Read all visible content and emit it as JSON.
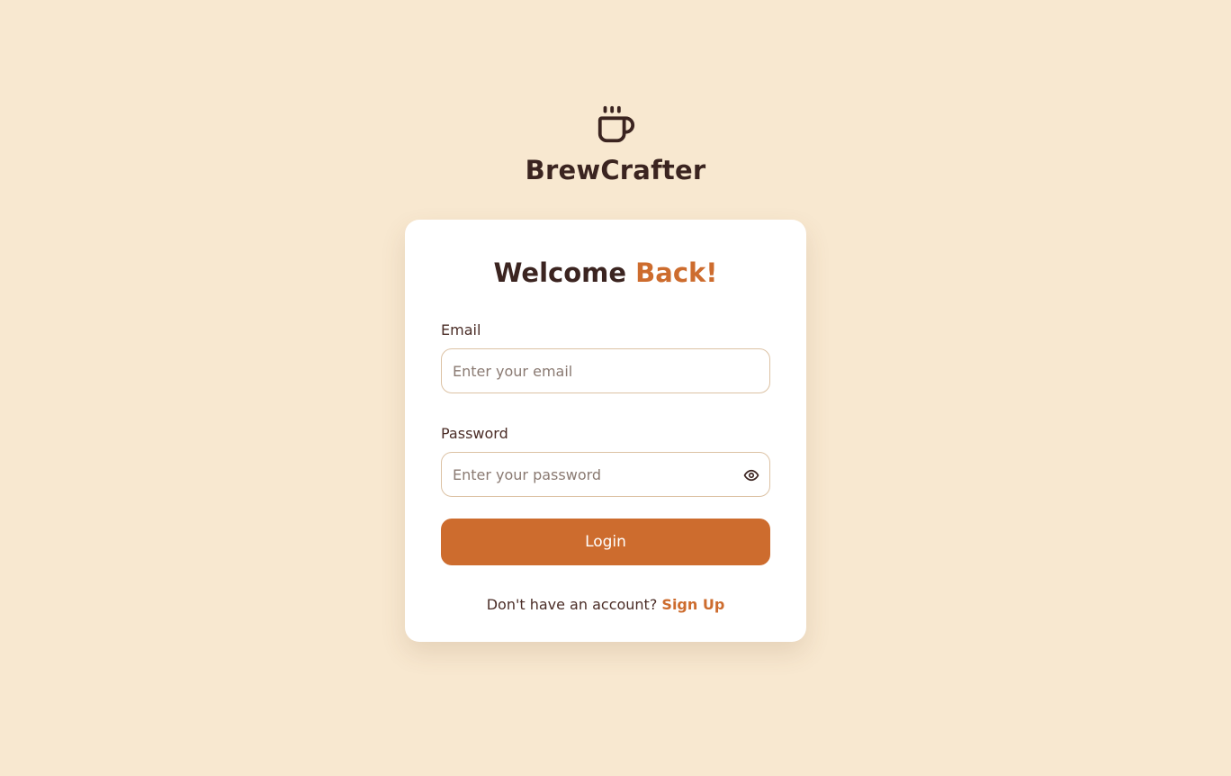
{
  "brand": {
    "name": "BrewCrafter",
    "icon": "coffee-cup-icon"
  },
  "card": {
    "title_main": "Welcome",
    "title_accent": "Back!",
    "email": {
      "label": "Email",
      "placeholder": "Enter your email",
      "value": ""
    },
    "password": {
      "label": "Password",
      "placeholder": "Enter your password",
      "value": "",
      "toggle_icon": "eye-icon"
    },
    "login_label": "Login",
    "signup_prompt": "Don't have an account?",
    "signup_link": "Sign Up"
  },
  "colors": {
    "background": "#f8e8d0",
    "accent": "#cd6c2e",
    "text_dark": "#3b2420",
    "input_border": "#dcc2a4"
  }
}
